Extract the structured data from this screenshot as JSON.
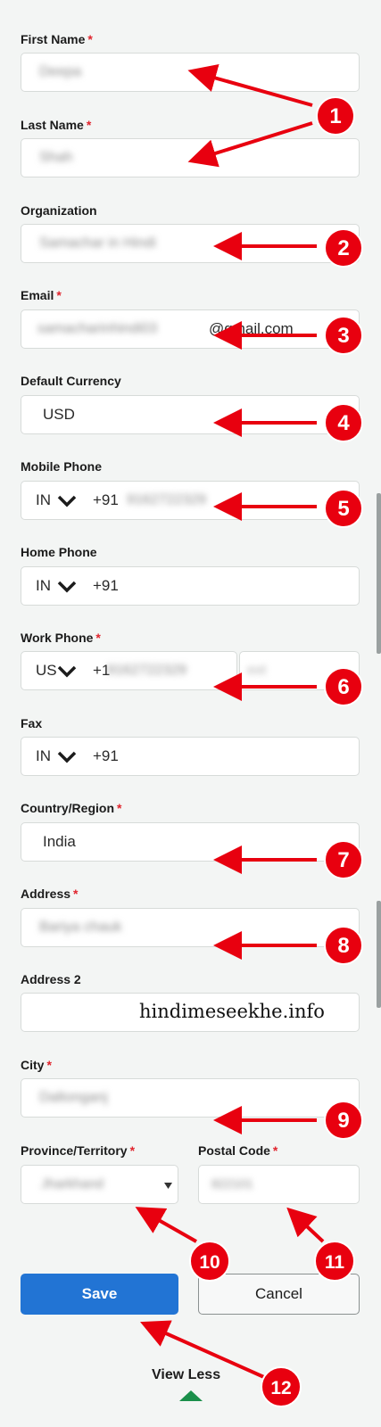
{
  "fields": {
    "first_name": {
      "label": "First Name",
      "required_mark": "*",
      "value": "Deepa"
    },
    "last_name": {
      "label": "Last Name",
      "required_mark": "*",
      "value": "Shah"
    },
    "organization": {
      "label": "Organization",
      "value": "Samachar in Hindi"
    },
    "email": {
      "label": "Email",
      "required_mark": "*",
      "value_blurred": "samacharinhindi03",
      "value_visible": "@gmail.com"
    },
    "currency": {
      "label": "Default Currency",
      "value": "USD"
    },
    "mobile_phone": {
      "label": "Mobile Phone",
      "country": "IN",
      "prefix": "+91",
      "number": "9162722329"
    },
    "home_phone": {
      "label": "Home Phone",
      "country": "IN",
      "prefix": "+91"
    },
    "work_phone": {
      "label": "Work Phone",
      "required_mark": "*",
      "country": "US",
      "prefix": "+1",
      "number": "9162722329",
      "ext_placeholder": "ext"
    },
    "fax": {
      "label": "Fax",
      "country": "IN",
      "prefix": "+91"
    },
    "country": {
      "label": "Country/Region",
      "required_mark": "*",
      "value": "India"
    },
    "address": {
      "label": "Address",
      "required_mark": "*",
      "value": "Bariya chauk"
    },
    "address2": {
      "label": "Address 2",
      "watermark": "hindimeseekhe.info"
    },
    "city": {
      "label": "City",
      "required_mark": "*",
      "value": "Daltonganj"
    },
    "province": {
      "label": "Province/Territory",
      "required_mark": "*",
      "value": "Jharkhand"
    },
    "postal_code": {
      "label": "Postal Code",
      "required_mark": "*",
      "value": "822101"
    }
  },
  "buttons": {
    "save": "Save",
    "cancel": "Cancel",
    "view_less": "View Less"
  },
  "annotations": [
    "1",
    "2",
    "3",
    "4",
    "5",
    "6",
    "7",
    "8",
    "9",
    "10",
    "11",
    "12"
  ],
  "colors": {
    "accent": "#2274d4",
    "arrow": "#e8000f",
    "required": "#e0242d",
    "view_less_caret": "#1a8f4a"
  }
}
